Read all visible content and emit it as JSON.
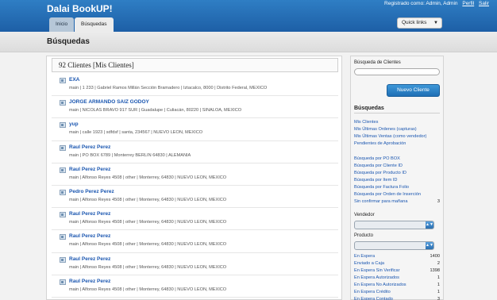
{
  "app": {
    "title": "Dalai BookUP!",
    "user_text": "Registrado como: Admin, Admin",
    "profile_link": "Perfil",
    "logout_link": "Salir"
  },
  "tabs": [
    {
      "label": "Inicio",
      "active": false
    },
    {
      "label": "Búsquedas",
      "active": true
    }
  ],
  "quick_links": {
    "label": "Quick links"
  },
  "page": {
    "title": "Búsquedas"
  },
  "main": {
    "title": "92 Clientes [Mis Clientes]",
    "clients": [
      {
        "name": "EXA",
        "detail": "main | 1 233 | Gabriel Ramos Millán Sección Bramadero | Iztacalco, 8000 | Distrito Federal, MEXICO"
      },
      {
        "name": "JORGE ARMANDO SAIZ GODOY",
        "detail": "main | NICOLAS BRAVO 917 SUR | Guadalupe | Culiacán, 80220 | SINALOA, MEXICO"
      },
      {
        "name": "yup",
        "detail": "main | calle 1923 | sdfdsf | santa, 234567 | NUEVO LEON, MEXICO"
      },
      {
        "name": "Raul Perez Perez",
        "detail": "main | PO BOX 6789 | Monterrey BERLIN 64830 | ALEMANIA"
      },
      {
        "name": "Raul Perez Perez",
        "detail": "main | Alfonso Reyes 4508 | other | Monterrey, 64830 | NUEVO LEON, MEXICO"
      },
      {
        "name": "Pedro Perez Perez",
        "detail": "main | Alfonso Reyes 4508 | other | Monterrey, 64830 | NUEVO LEON, MEXICO"
      },
      {
        "name": "Raul Perez Perez",
        "detail": "main | Alfonso Reyes 4508 | other | Monterrey, 64830 | NUEVO LEON, MEXICO"
      },
      {
        "name": "Raul Perez Perez",
        "detail": "main | Alfonso Reyes 4508 | other | Monterrey, 64830 | NUEVO LEON, MEXICO"
      },
      {
        "name": "Raul Perez Perez",
        "detail": "main | Alfonso Reyes 4508 | other | Monterrey, 64830 | NUEVO LEON, MEXICO"
      },
      {
        "name": "Raul Perez Perez",
        "detail": "main | Alfonso Reyes 4508 | other | Monterrey, 64830 | NUEVO LEON, MEXICO"
      }
    ]
  },
  "sidebar": {
    "search_label": "Búsqueda de Clientes",
    "search_value": "",
    "new_client_button": "Nuevo Cliente",
    "searches_heading": "Búsquedas",
    "group1": [
      {
        "label": "Mis Clientes",
        "count": ""
      },
      {
        "label": "Mis Últimas Ordenes (capturas)",
        "count": ""
      },
      {
        "label": "Mis Últimas Ventas (como vendedor)",
        "count": ""
      },
      {
        "label": "Pendientes de Aprobación",
        "count": ""
      }
    ],
    "group2": [
      {
        "label": "Búsqueda por PO BOX",
        "count": ""
      },
      {
        "label": "Búsqueda por Cliente ID",
        "count": ""
      },
      {
        "label": "Búsqueda por Producto ID",
        "count": ""
      },
      {
        "label": "Búsqueda por Item ID",
        "count": ""
      },
      {
        "label": "Búsqueda por Factura Folio",
        "count": ""
      },
      {
        "label": "Búsqueda por Orden de Inserción",
        "count": ""
      },
      {
        "label": "Sin confirmar para mañana",
        "count": "3"
      }
    ],
    "vendor_label": "Vendedor",
    "product_label": "Producto",
    "group3": [
      {
        "label": "En Espera",
        "count": "1400"
      },
      {
        "label": "Enviado a Caja",
        "count": "2"
      },
      {
        "label": "En Espera Sin Verificar",
        "count": "1398"
      },
      {
        "label": "En Espera Autorizados",
        "count": "1"
      },
      {
        "label": "En Espera No Autorizados",
        "count": "1"
      },
      {
        "label": "En Espera Crédito",
        "count": "1"
      },
      {
        "label": "En Espera Contado",
        "count": "3"
      }
    ]
  },
  "colors": {
    "header_blue": "#1d5fa6",
    "link_blue": "#1a56b0",
    "button_blue": "#2b82c9"
  }
}
